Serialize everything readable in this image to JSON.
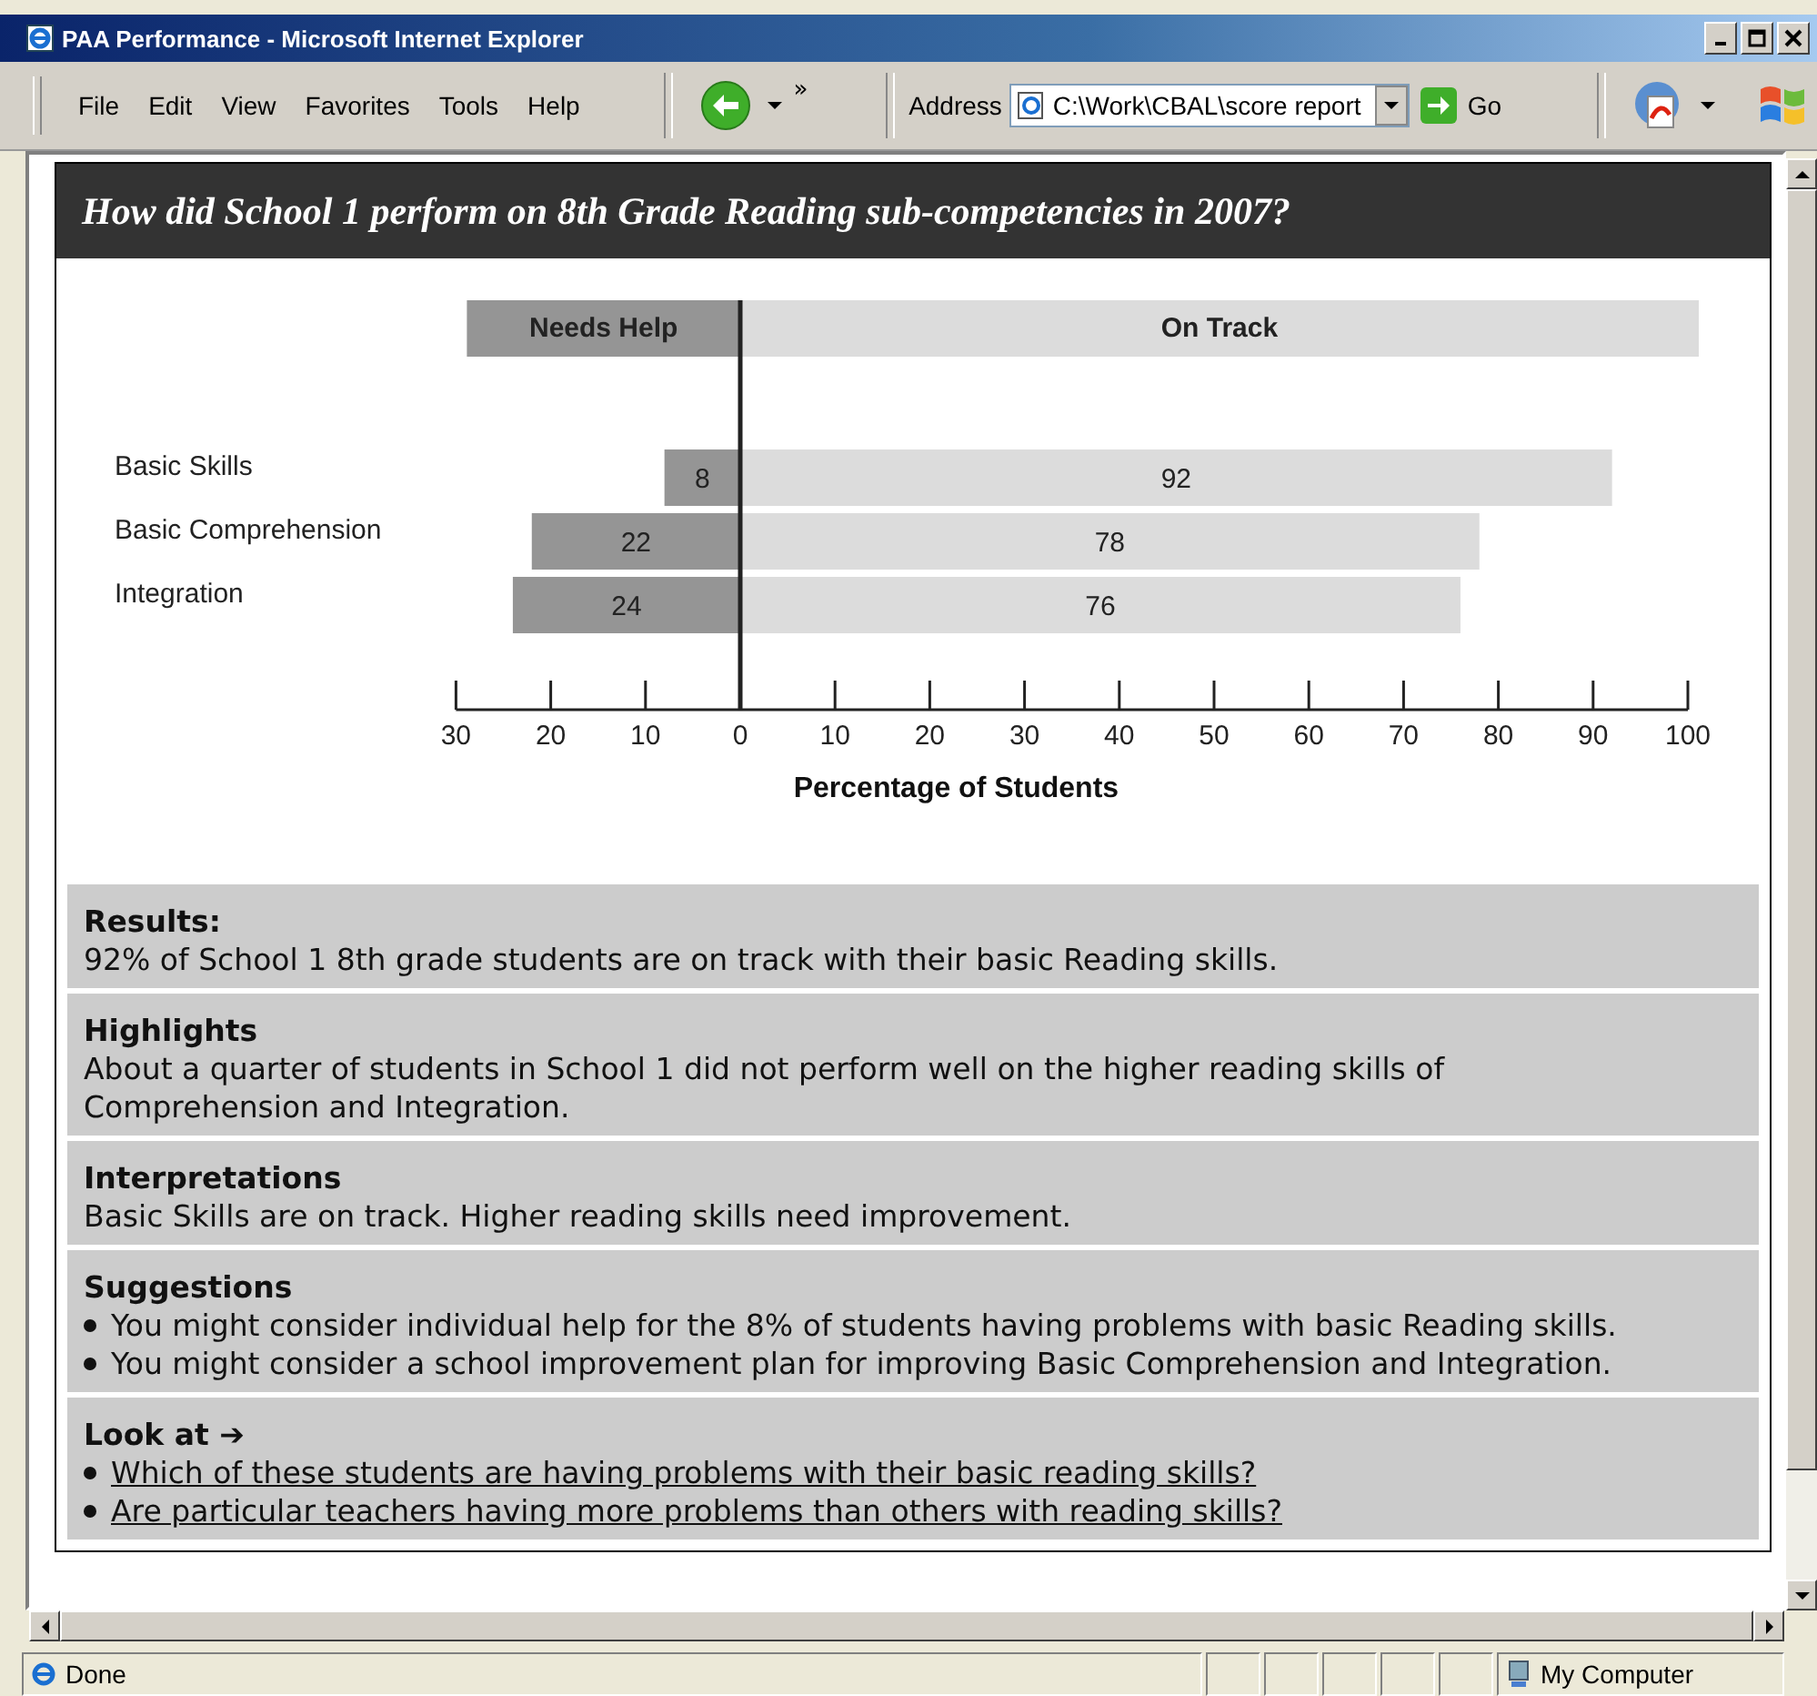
{
  "window": {
    "title": "PAA Performance - Microsoft Internet Explorer"
  },
  "menu": [
    "File",
    "Edit",
    "View",
    "Favorites",
    "Tools",
    "Help"
  ],
  "toolbar": {
    "chevron": "»",
    "address_label": "Address",
    "address_value": "C:\\Work\\CBAL\\score report",
    "go": "Go"
  },
  "page": {
    "heading": "How did School 1 perform on 8th Grade Reading sub-competencies in 2007?",
    "chart_data": {
      "type": "bar",
      "orientation": "horizontal",
      "stacked": true,
      "xlabel": "Percentage of Students",
      "categories": [
        "Basic Skills",
        "Basic Comprehension",
        "Integration"
      ],
      "series": [
        {
          "name": "Needs Help",
          "color": "#959595",
          "values": [
            -8,
            -22,
            -24
          ]
        },
        {
          "name": "On Track",
          "color": "#dcdcdc",
          "values": [
            92,
            78,
            76
          ]
        }
      ],
      "xlim": [
        -30,
        100
      ],
      "value_labels": [
        [
          "8",
          "22",
          "24"
        ],
        [
          "92",
          "78",
          "76"
        ]
      ],
      "xticks": [
        {
          "value": -30,
          "label": "30"
        },
        {
          "value": -20,
          "label": "20"
        },
        {
          "value": -10,
          "label": "10"
        },
        0,
        10,
        20,
        30,
        40,
        50,
        60,
        70,
        80,
        90,
        100
      ]
    },
    "sections": [
      {
        "kind": "paragraph",
        "heading": "Results:",
        "text": "92% of School 1 8th grade students are on track with their basic Reading skills."
      },
      {
        "kind": "paragraph",
        "heading": "Highlights",
        "text": "About a quarter of students in School 1 did not perform well on the higher reading skills of Comprehension and Integration."
      },
      {
        "kind": "paragraph",
        "heading": "Interpretations",
        "text": "Basic Skills are on track. Higher reading skills need improvement."
      },
      {
        "kind": "bullets",
        "heading": "Suggestions",
        "items": [
          "You might consider individual help for the 8% of students having problems with basic Reading skills.",
          "You might consider a school improvement plan for improving Basic Comprehension and Integration."
        ]
      },
      {
        "kind": "links",
        "heading": "Look at ➔",
        "items": [
          "Which of these students are having problems with their basic reading skills?",
          " Are particular teachers having more problems than others with reading skills?"
        ]
      }
    ]
  },
  "status_bar": {
    "text": "Done",
    "zone": "My Computer"
  }
}
